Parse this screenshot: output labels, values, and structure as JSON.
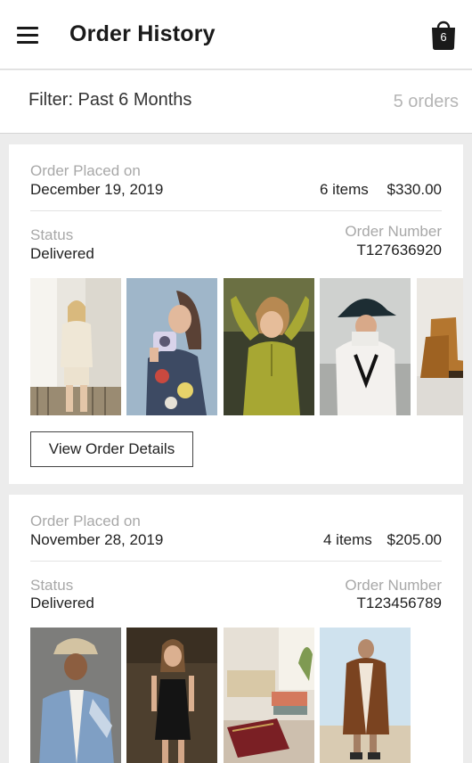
{
  "header": {
    "title": "Order History",
    "bag_count": "6",
    "menu_icon": "hamburger-menu-icon",
    "bag_icon": "shopping-bag-icon"
  },
  "filter": {
    "label": "Filter: Past 6 Months",
    "count": "5 orders"
  },
  "labels": {
    "placed": "Order Placed on",
    "status": "Status",
    "order_number": "Order Number",
    "view_details": "View Order Details"
  },
  "orders": [
    {
      "date": "December 19, 2019",
      "items": "6 items",
      "total": "$330.00",
      "status": "Delivered",
      "number": "T127636920",
      "thumbnails": [
        "cream-knit-loungewear",
        "floral-jacket-with-camera",
        "olive-henley-top",
        "white-fleece-with-black-hat",
        "tan-work-boots"
      ]
    },
    {
      "date": "November 28, 2019",
      "items": "4 items",
      "total": "$205.00",
      "status": "Delivered",
      "number": "T123456789",
      "thumbnails": [
        "denim-jacket-with-bucket-hat",
        "black-slip-dress",
        "home-decor-cushions",
        "brown-shearling-coat"
      ]
    }
  ],
  "colors": {
    "background": "#ececec",
    "card": "#ffffff",
    "muted_text": "#a8a8a8",
    "primary_text": "#1f1f1f"
  }
}
